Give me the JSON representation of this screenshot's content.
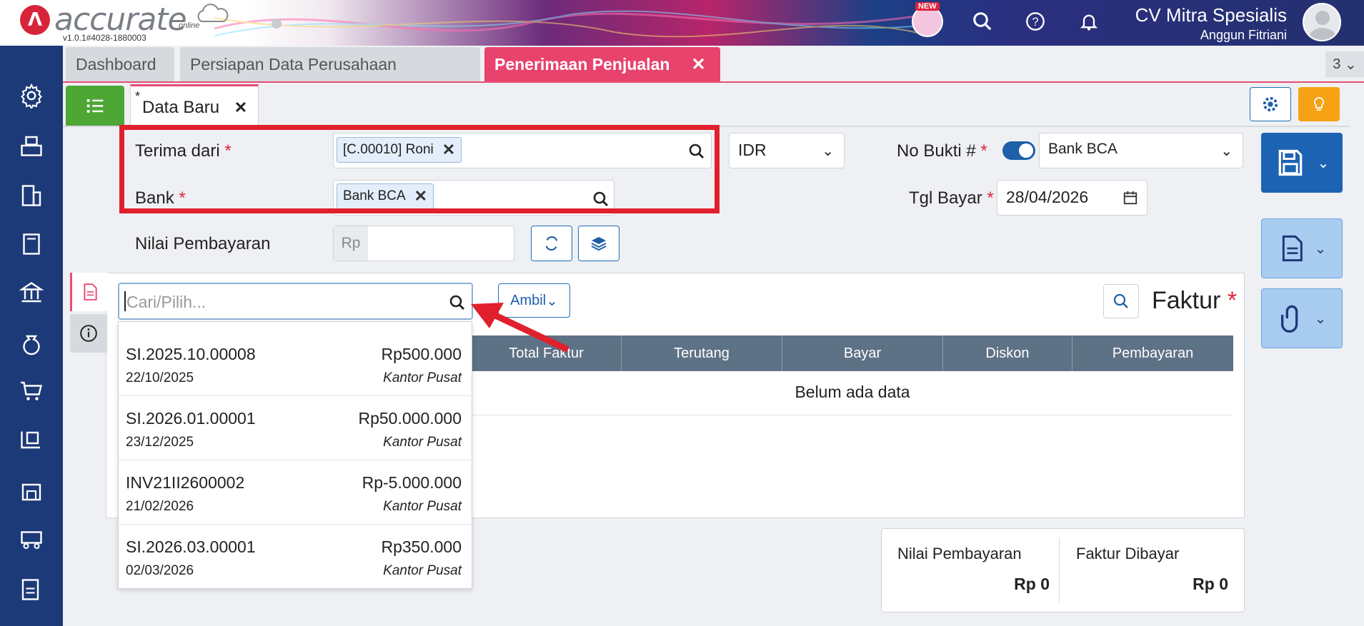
{
  "header": {
    "app_name": "accurate",
    "app_subtitle": "online",
    "version": "v1.0.1#4028-1880003",
    "new_badge": "NEW",
    "company": "CV Mitra Spesialis",
    "user": "Anggun Fitriani"
  },
  "tabs": [
    {
      "label": "Dashboard"
    },
    {
      "label": "Persiapan Data Perusahaan"
    },
    {
      "label": "Penerimaan Penjualan"
    }
  ],
  "tab_count": "3",
  "subtab": {
    "label": "Data Baru",
    "marker": "*"
  },
  "form": {
    "terima_dari_label": "Terima dari",
    "terima_dari_value": "[C.00010] Roni",
    "bank_label": "Bank",
    "bank_value": "Bank BCA",
    "nilai_label": "Nilai Pembayaran",
    "nilai_prefix": "Rp",
    "currency": "IDR",
    "no_bukti_label": "No Bukti #",
    "no_bukti_value": "Bank BCA",
    "tgl_bayar_label": "Tgl Bayar",
    "tgl_bayar_value": "28/04/2026",
    "required_mark": "*"
  },
  "detail": {
    "search_placeholder": "Cari/Pilih...",
    "ambil_label": "Ambil",
    "faktur_title": "Faktur",
    "columns": [
      "Total Faktur",
      "Terutang",
      "Bayar",
      "Diskon",
      "Pembayaran"
    ],
    "empty_text": "Belum ada data"
  },
  "dropdown_items": [
    {
      "code": "SI.2025.10.00008",
      "amount": "Rp500.000",
      "date": "22/10/2025",
      "branch": "Kantor Pusat"
    },
    {
      "code": "SI.2026.01.00001",
      "amount": "Rp50.000.000",
      "date": "23/12/2025",
      "branch": "Kantor Pusat"
    },
    {
      "code": "INV21II2600002",
      "amount": "Rp-5.000.000",
      "date": "21/02/2026",
      "branch": "Kantor Pusat"
    },
    {
      "code": "SI.2026.03.00001",
      "amount": "Rp350.000",
      "date": "02/03/2026",
      "branch": "Kantor Pusat"
    }
  ],
  "summary": {
    "nilai_label": "Nilai Pembayaran",
    "nilai_value": "Rp 0",
    "faktur_label": "Faktur Dibayar",
    "faktur_value": "Rp 0"
  },
  "colors": {
    "accent_pink": "#e8436d",
    "sidebar_blue": "#1d3a78",
    "highlight_red": "#e0202c",
    "table_header": "#5e7286"
  }
}
